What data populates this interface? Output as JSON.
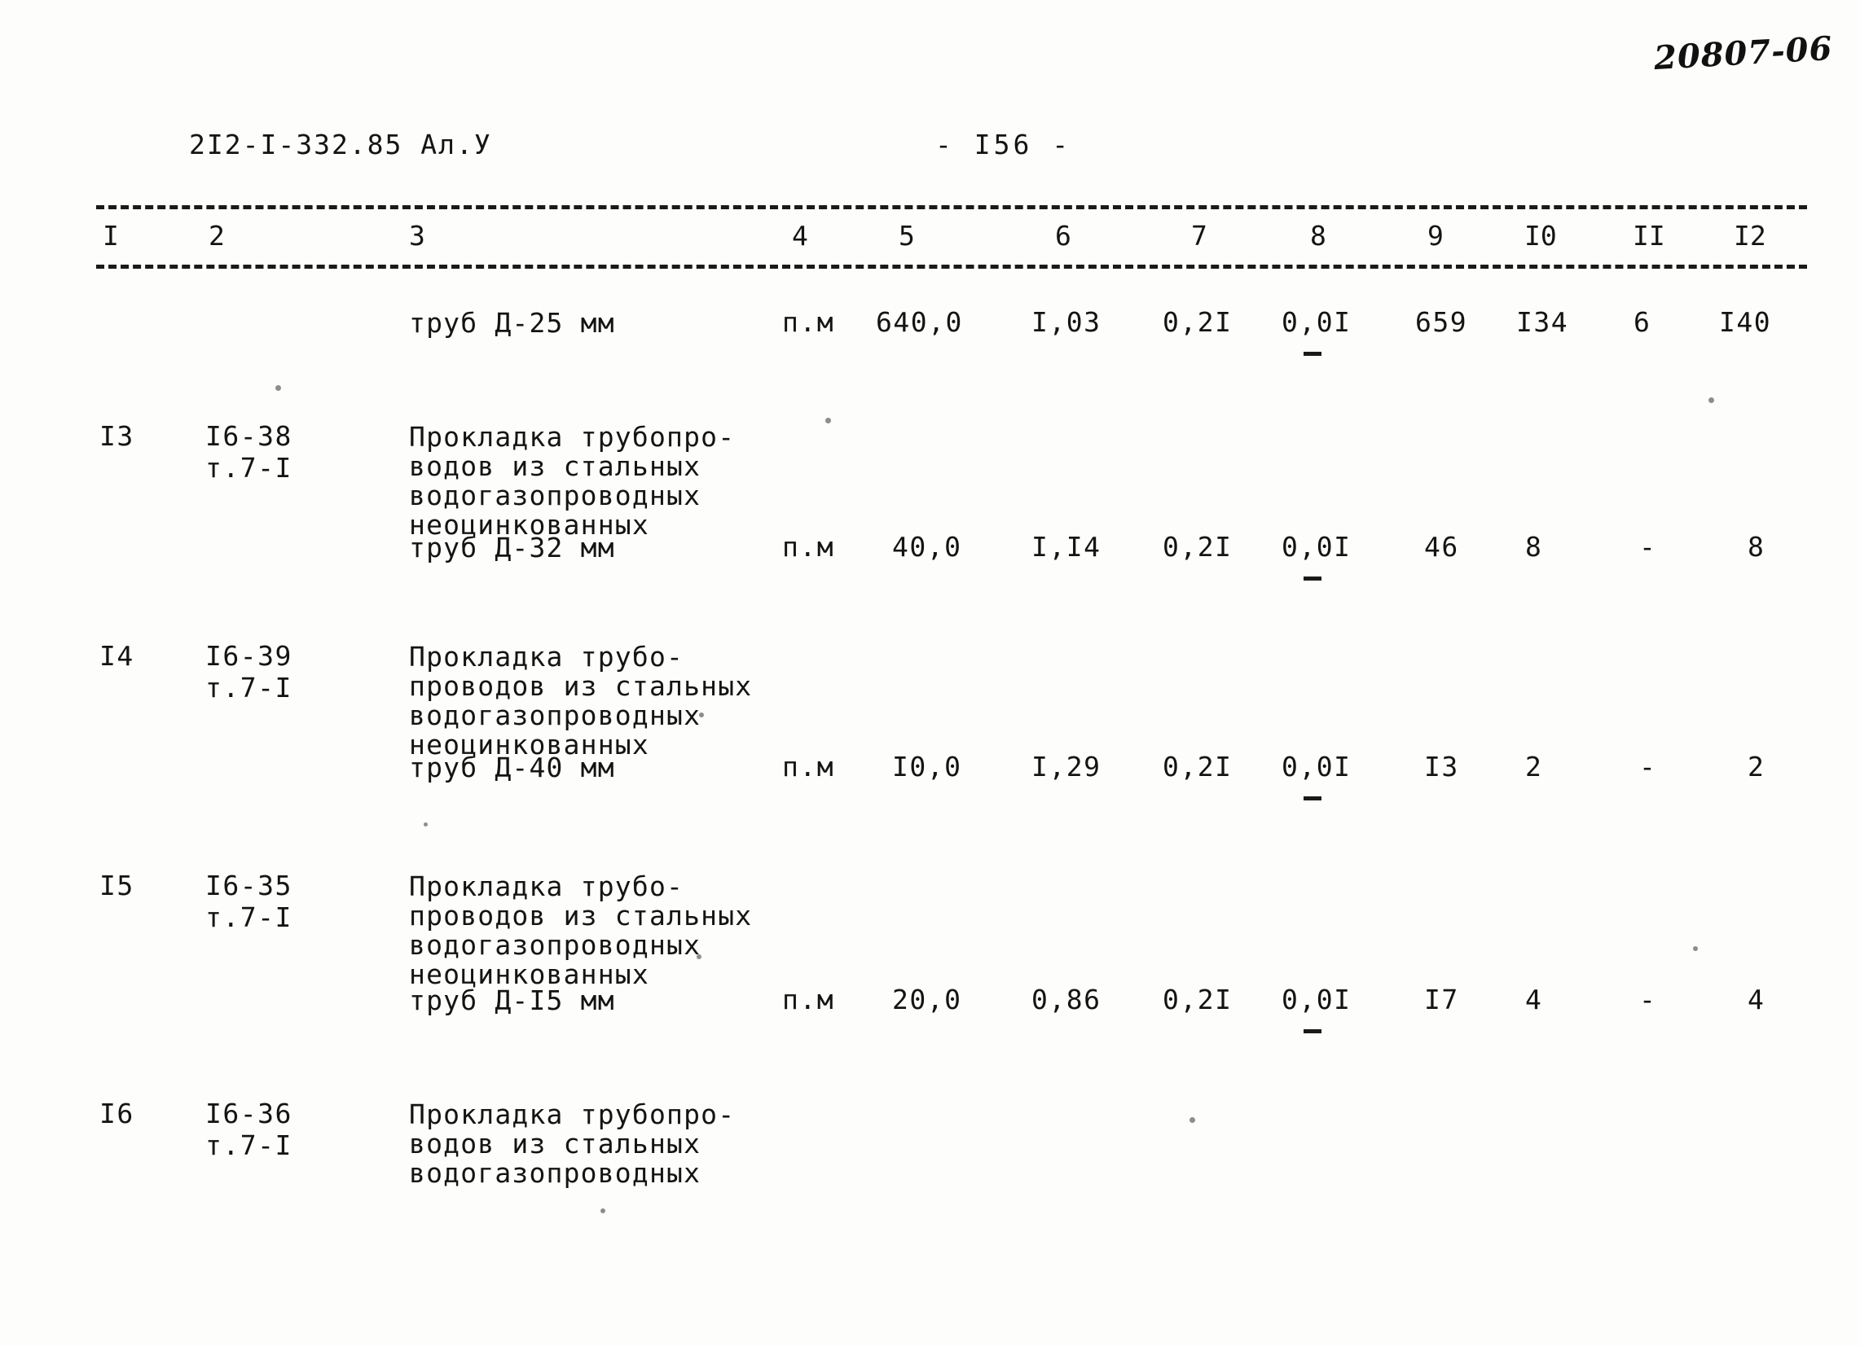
{
  "document": {
    "archive_stamp": "20807-06",
    "header_code": "2I2-I-332.85 Ал.У",
    "page_marker": "- I56 -"
  },
  "table": {
    "column_headers": [
      "I",
      "2",
      "3",
      "4",
      "5",
      "6",
      "7",
      "8",
      "9",
      "I0",
      "II",
      "I2"
    ],
    "rows": [
      {
        "num": "",
        "code": "",
        "description": [
          "труб Д-25 мм"
        ],
        "unit": "п.м",
        "c5": "640,0",
        "c6": "I,03",
        "c7": "0,2I",
        "c8": "0,0I",
        "c9": "659",
        "c10": "I34",
        "c11": "6",
        "c12": "I40"
      },
      {
        "num": "I3",
        "code": "I6-38",
        "code2": "т.7-I",
        "description": [
          "Прокладка трубопро-",
          "водов из стальных",
          "водогазопроводных",
          "неоцинкованных",
          "труб Д-32 мм"
        ],
        "unit": "п.м",
        "c5": "40,0",
        "c6": "I,I4",
        "c7": "0,2I",
        "c8": "0,0I",
        "c9": "46",
        "c10": "8",
        "c11": "-",
        "c12": "8"
      },
      {
        "num": "I4",
        "code": "I6-39",
        "code2": "т.7-I",
        "description": [
          "Прокладка трубо-",
          "проводов из стальных",
          "водогазопроводных",
          "неоцинкованных",
          "труб Д-40 мм"
        ],
        "unit": "п.м",
        "c5": "I0,0",
        "c6": "I,29",
        "c7": "0,2I",
        "c8": "0,0I",
        "c9": "I3",
        "c10": "2",
        "c11": "-",
        "c12": "2"
      },
      {
        "num": "I5",
        "code": "I6-35",
        "code2": "т.7-I",
        "description": [
          "Прокладка трубо-",
          "проводов из стальных",
          "водогазопроводных",
          "неоцинкованных",
          "труб Д-I5 мм"
        ],
        "unit": "п.м",
        "c5": "20,0",
        "c6": "0,86",
        "c7": "0,2I",
        "c8": "0,0I",
        "c9": "I7",
        "c10": "4",
        "c11": "-",
        "c12": "4"
      },
      {
        "num": "I6",
        "code": "I6-36",
        "code2": "т.7-I",
        "description": [
          "Прокладка трубопро-",
          "водов из стальных",
          "водогазопроводных"
        ],
        "unit": "",
        "c5": "",
        "c6": "",
        "c7": "",
        "c8": "",
        "c9": "",
        "c10": "",
        "c11": "",
        "c12": ""
      }
    ]
  }
}
